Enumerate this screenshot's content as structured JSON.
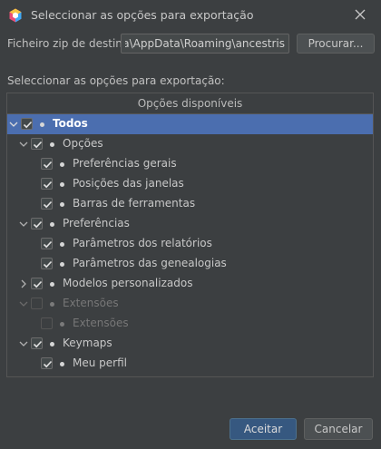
{
  "window": {
    "title": "Seleccionar as opções para exportação",
    "app_icon": "app-hexagon-icon",
    "close_icon": "close-icon"
  },
  "zip": {
    "label": "Ficheiro zip de destino:",
    "value": "C:\\Users\\ara\\AppData\\Roaming\\ancestris\\",
    "browse_label": "Procurar..."
  },
  "section": {
    "label": "Seleccionar as opções para exportação:"
  },
  "tree": {
    "header": "Opções disponíveis",
    "nodes": [
      {
        "label": "Todos",
        "expanded": true,
        "checked": true,
        "enabled": true,
        "selected": true
      },
      {
        "label": "Opções",
        "expanded": true,
        "checked": true,
        "enabled": true
      },
      {
        "label": "Preferências gerais",
        "checked": true,
        "enabled": true
      },
      {
        "label": "Posições das janelas",
        "checked": true,
        "enabled": true
      },
      {
        "label": "Barras de ferramentas",
        "checked": true,
        "enabled": true
      },
      {
        "label": "Preferências",
        "expanded": true,
        "checked": true,
        "enabled": true
      },
      {
        "label": "Parâmetros dos relatórios",
        "checked": true,
        "enabled": true
      },
      {
        "label": "Parâmetros das genealogias",
        "checked": true,
        "enabled": true
      },
      {
        "label": "Modelos personalizados",
        "expanded": false,
        "checked": true,
        "enabled": true
      },
      {
        "label": "Extensões",
        "expanded": true,
        "checked": false,
        "enabled": false
      },
      {
        "label": "Extensões",
        "checked": false,
        "enabled": false
      },
      {
        "label": "Keymaps",
        "expanded": true,
        "checked": true,
        "enabled": true
      },
      {
        "label": "Meu perfil",
        "checked": true,
        "enabled": true
      }
    ]
  },
  "buttons": {
    "ok": "Aceitar",
    "cancel": "Cancelar"
  },
  "colors": {
    "background": "#3c3f41",
    "selection": "#4b6eaf",
    "primary_button": "#365880"
  }
}
